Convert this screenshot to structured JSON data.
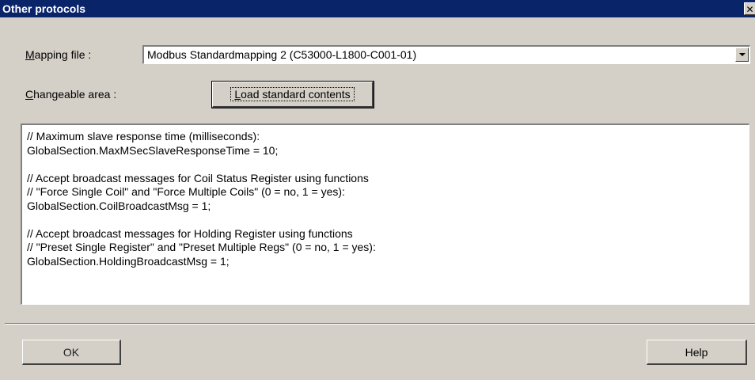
{
  "window": {
    "title": "Other protocols",
    "close_glyph": "✕"
  },
  "mapping": {
    "label_accel": "M",
    "label_rest": "apping file :",
    "selected_value": "Modbus Standardmapping 2 (C53000-L1800-C001-01)"
  },
  "changeable": {
    "label_accel": "C",
    "label_rest": "hangeable area :",
    "load_button_accel": "L",
    "load_button_rest": "oad standard contents"
  },
  "content_lines": [
    "// Maximum slave response time (milliseconds):",
    "GlobalSection.MaxMSecSlaveResponseTime = 10;",
    "",
    "// Accept broadcast messages for Coil Status Register using functions",
    "// \"Force Single Coil\" and \"Force Multiple Coils\" (0 = no, 1 = yes):",
    "GlobalSection.CoilBroadcastMsg = 1;",
    "",
    "// Accept broadcast messages for Holding Register using functions",
    "// \"Preset Single Register\" and \"Preset Multiple Regs\" (0 = no, 1 = yes):",
    "GlobalSection.HoldingBroadcastMsg = 1;"
  ],
  "footer": {
    "ok_label": "OK",
    "help_label": "Help"
  }
}
